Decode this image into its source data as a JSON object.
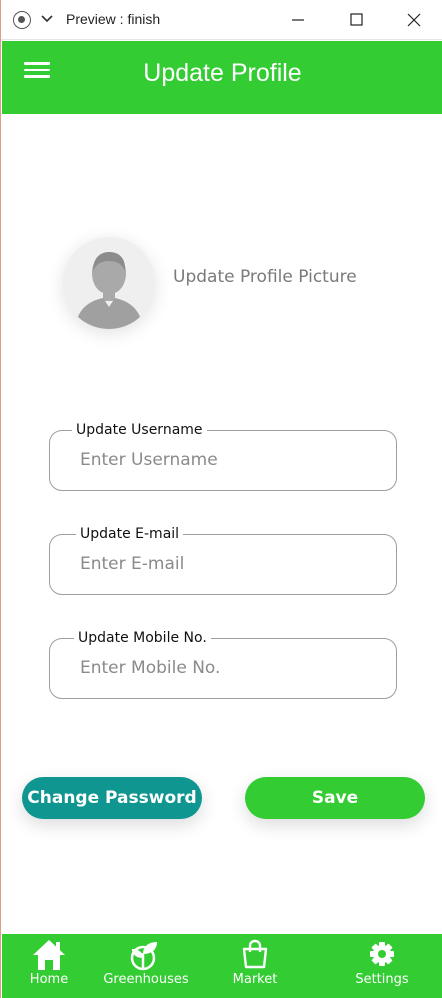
{
  "titlebar": {
    "title": "Preview : finish"
  },
  "header": {
    "title": "Update Profile"
  },
  "profile": {
    "picture_label": "Update Profile Picture"
  },
  "form": {
    "username": {
      "label": "Update Username",
      "placeholder": "Enter Username"
    },
    "email": {
      "label": "Update E-mail",
      "placeholder": "Enter E-mail"
    },
    "mobile": {
      "label": "Update Mobile No.",
      "placeholder": "Enter Mobile No."
    }
  },
  "buttons": {
    "change_password": "Change Password",
    "save": "Save"
  },
  "nav": {
    "items": [
      {
        "label": "Home",
        "icon": "home-icon"
      },
      {
        "label": "Greenhouses",
        "icon": "plant-icon"
      },
      {
        "label": "Market",
        "icon": "shopping-bag-icon"
      },
      {
        "label": "Settings",
        "icon": "gear-icon"
      }
    ]
  },
  "colors": {
    "primary_green": "#33cc33",
    "teal": "#109691"
  }
}
